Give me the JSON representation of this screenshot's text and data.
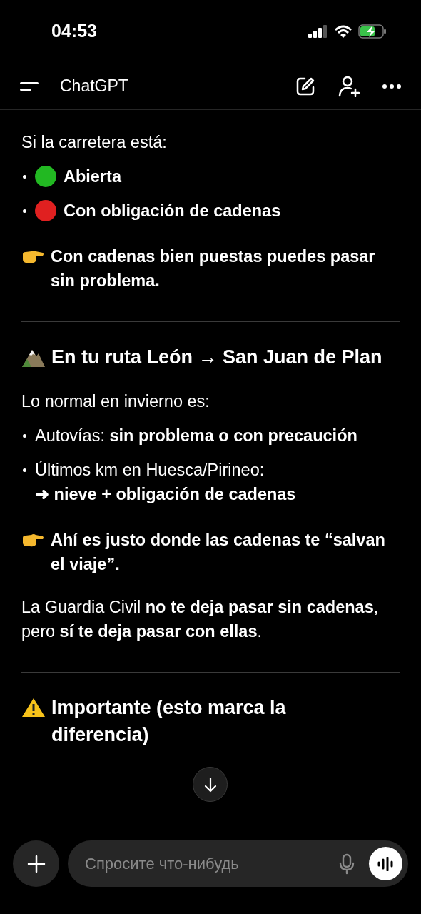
{
  "status_bar": {
    "time": "04:53"
  },
  "header": {
    "title": "ChatGPT"
  },
  "message": [
    {
      "kind": "text",
      "text": "Si la carretera está:"
    },
    {
      "kind": "bullet",
      "text": "Abierta",
      "bold": true,
      "color": "#22b822"
    },
    {
      "kind": "bullet",
      "text": "Con obligación de cadenas",
      "bold": true,
      "color": "#e02020"
    },
    {
      "kind": "tip",
      "text": "Con cadenas bien puestas puedes pasar sin problema."
    },
    {
      "kind": "divider"
    },
    {
      "kind": "mountain_heading",
      "text": "En tu ruta León → San Juan de Plan"
    },
    {
      "kind": "text",
      "text": "Lo normal en invierno es:"
    },
    {
      "kind": "bullet",
      "text": "Autovías: **sin problema o con precaución**",
      "bold": false
    },
    {
      "kind": "bullet",
      "text": "Últimos km en Huesca/Pirineo:",
      "bold": false,
      "continuation": "➜ nieve + obligación de cadenas"
    },
    {
      "kind": "tip",
      "text": "Ahí es justo donde las cadenas te “salvan el viaje”."
    },
    {
      "kind": "text",
      "text": "La Guardia Civil **no te deja pasar sin cadenas**, pero **sí te deja pasar con ellas**."
    },
    {
      "kind": "divider"
    },
    {
      "kind": "warning_heading",
      "text": "Importante (esto marca la diferencia)"
    }
  ],
  "composer": {
    "placeholder": "Спросите что-нибудь"
  }
}
